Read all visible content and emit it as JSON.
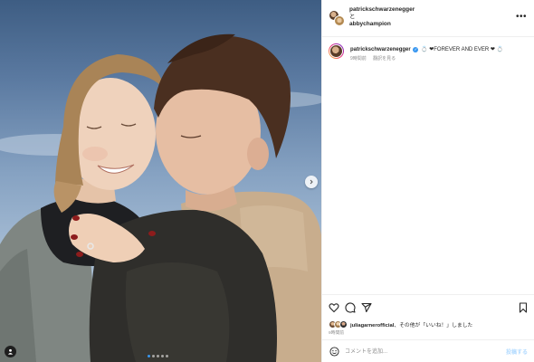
{
  "header": {
    "account_primary": "patrickschwarzenegger",
    "and_text": "と",
    "account_secondary": "abbychampion",
    "more_label": "•••"
  },
  "caption": {
    "username": "patrickschwarzenegger",
    "verified_mark": "✓",
    "text_before": "💍",
    "text": "❤FOREVER AND EVER ❤",
    "text_after": "💍",
    "time_ago": "9時間前",
    "translate_label": "翻訳を見る"
  },
  "actions": {
    "liked_by": "juliagarnerofficial",
    "likes_suffix": "、その他が「いいね！」しました",
    "timestamp": "9時間前"
  },
  "comment": {
    "placeholder": "コメントを追加...",
    "post_label": "投稿する"
  },
  "carousel": {
    "slide_count": 5,
    "active_index": 0
  },
  "colors": {
    "accent": "#3897f0",
    "post_disabled": "#b3dbff",
    "muted_text": "#8e8e8e",
    "border": "#efefef"
  },
  "icons": [
    "heart-icon",
    "comment-icon",
    "share-icon",
    "bookmark-icon",
    "emoji-icon",
    "user-tag-icon",
    "chevron-right-icon",
    "more-icon"
  ]
}
